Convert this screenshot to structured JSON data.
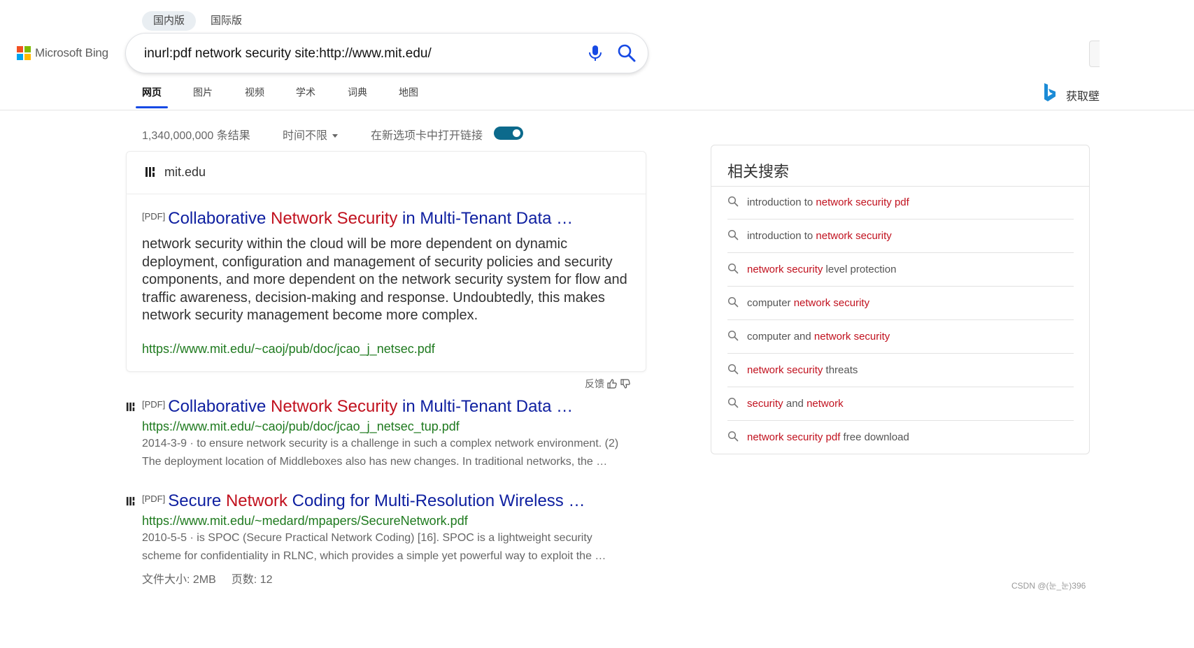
{
  "region_tabs": [
    {
      "label": "国内版",
      "active": true
    },
    {
      "label": "国际版",
      "active": false
    }
  ],
  "logo": {
    "text": "Microsoft Bing"
  },
  "search": {
    "query": "inurl:pdf network security site:http://www.mit.edu/"
  },
  "nav_tabs": [
    {
      "label": "网页",
      "active": true
    },
    {
      "label": "图片",
      "active": false
    },
    {
      "label": "视频",
      "active": false
    },
    {
      "label": "学术",
      "active": false
    },
    {
      "label": "词典",
      "active": false
    },
    {
      "label": "地图",
      "active": false
    }
  ],
  "header_right": {
    "reward_text": "获取壁"
  },
  "filters": {
    "result_count": "1,340,000,000 条结果",
    "time_filter": "时间不限",
    "new_tab_label": "在新选项卡中打开链接",
    "new_tab_enabled": true
  },
  "featured_result": {
    "site_name": "mit.edu",
    "pdf_tag": "[PDF]",
    "title_parts": [
      {
        "text": "Collaborative ",
        "hl": false
      },
      {
        "text": "Network Security",
        "hl": true
      },
      {
        "text": " in Multi-Tenant Data …",
        "hl": false
      }
    ],
    "snippet": "network security within the cloud will be more dependent on dynamic deployment, configuration and management of security policies and security components, and more dependent on the network security system for flow and traffic awareness, decision-making and response. Undoubtedly, this makes network security management become more complex.",
    "url": "https://www.mit.edu/~caoj/pub/doc/jcao_j_netsec.pdf"
  },
  "feedback_label": "反馈",
  "results": [
    {
      "pdf_tag": "[PDF]",
      "title_parts": [
        {
          "text": "Collaborative ",
          "hl": false
        },
        {
          "text": "Network Security",
          "hl": true
        },
        {
          "text": " in Multi-Tenant Data …",
          "hl": false
        }
      ],
      "url": "https://www.mit.edu/~caoj/pub/doc/jcao_j_netsec_tup.pdf",
      "date": "2014-3-9",
      "separator": " · ",
      "snippet_line1": "to ensure network security is a challenge in such a complex network environment. (2)",
      "snippet_line2": "The deployment location of Middleboxes also has new changes. In traditional networks, the …"
    },
    {
      "pdf_tag": "[PDF]",
      "title_parts": [
        {
          "text": "Secure ",
          "hl": false
        },
        {
          "text": "Network",
          "hl": true
        },
        {
          "text": " Coding for Multi-Resolution Wireless …",
          "hl": false
        }
      ],
      "url": "https://www.mit.edu/~medard/mpapers/SecureNetwork.pdf",
      "date": "2010-5-5",
      "separator": " · ",
      "snippet_line1": "is SPOC (Secure Practical Network Coding) [16]. SPOC is a lightweight security",
      "snippet_line2": "scheme for confidentiality in RLNC, which provides a simple yet powerful way to exploit the …",
      "file_size": "文件大小: 2MB",
      "page_count": "页数: 12"
    }
  ],
  "related": {
    "title": "相关搜索",
    "items": [
      [
        {
          "t": "introduction to ",
          "h": false
        },
        {
          "t": "network security pdf",
          "h": true
        }
      ],
      [
        {
          "t": "introduction to ",
          "h": false
        },
        {
          "t": "network security",
          "h": true
        }
      ],
      [
        {
          "t": "network security",
          "h": true
        },
        {
          "t": " level protection",
          "h": false
        }
      ],
      [
        {
          "t": "computer ",
          "h": false
        },
        {
          "t": "network security",
          "h": true
        }
      ],
      [
        {
          "t": "computer and ",
          "h": false
        },
        {
          "t": "network security",
          "h": true
        }
      ],
      [
        {
          "t": "network security",
          "h": true
        },
        {
          "t": " threats",
          "h": false
        }
      ],
      [
        {
          "t": "security",
          "h": true
        },
        {
          "t": " and ",
          "h": false
        },
        {
          "t": "network",
          "h": true
        }
      ],
      [
        {
          "t": "network security pdf",
          "h": true
        },
        {
          "t": " free download",
          "h": false
        }
      ]
    ]
  },
  "watermark": "CSDN @(눈_눈)396",
  "colors": {
    "link_blue": "#0e1fa0",
    "highlight_red": "#c1121f",
    "url_green": "#1f7a1f",
    "toggle_teal": "#0c6a8c",
    "tab_underline": "#174ae4"
  }
}
